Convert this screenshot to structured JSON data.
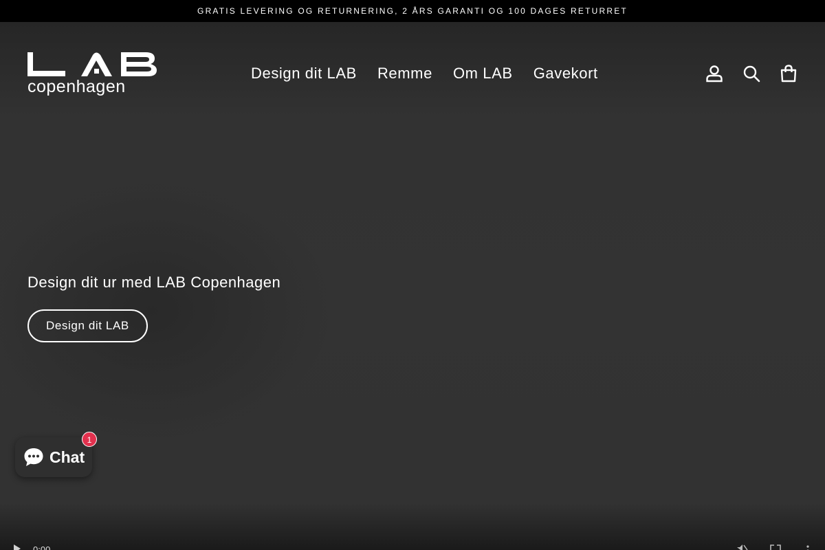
{
  "announcement": {
    "text": "GRATIS LEVERING OG RETURNERING, 2 ÅRS GARANTI OG 100 DAGES RETURRET"
  },
  "logo": {
    "wordmark": "LAB",
    "subtitle": "copenhagen"
  },
  "nav": {
    "items": [
      {
        "label": "Design dit LAB"
      },
      {
        "label": "Remme"
      },
      {
        "label": "Om LAB"
      },
      {
        "label": "Gavekort"
      }
    ]
  },
  "header_icons": [
    "account-icon",
    "search-icon",
    "cart-icon"
  ],
  "hero": {
    "title": "Design dit ur med LAB Copenhagen",
    "button_label": "Design dit LAB"
  },
  "chat": {
    "label": "Chat",
    "badge_count": "1",
    "badge_color": "#e2314e"
  },
  "video": {
    "time": "0:00"
  },
  "colors": {
    "background": "#333333",
    "announcement_bar": "#000000",
    "text": "#ffffff"
  }
}
